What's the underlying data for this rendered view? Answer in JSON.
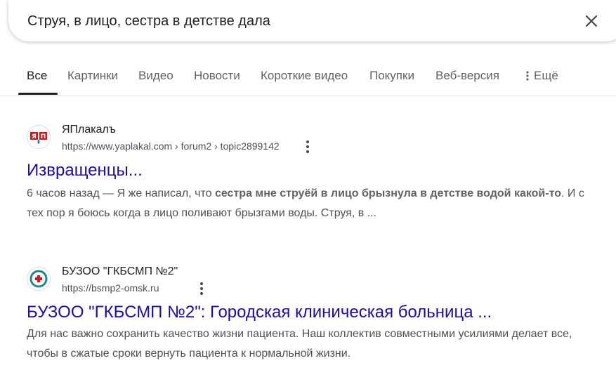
{
  "search": {
    "query": "Струя, в лицо, сестра в детстве дала",
    "clear_icon": "close-icon"
  },
  "tabs": [
    {
      "label": "Все",
      "active": true
    },
    {
      "label": "Картинки"
    },
    {
      "label": "Видео"
    },
    {
      "label": "Новости"
    },
    {
      "label": "Короткие видео"
    },
    {
      "label": "Покупки"
    },
    {
      "label": "Веб-версия"
    },
    {
      "label": "Ещё",
      "icon": "more-vert-icon"
    }
  ],
  "results": [
    {
      "site_name": "ЯПлакалъ",
      "url": "https://www.yaplakal.com › forum2 › topic2899142",
      "title": "Извращенцы...",
      "snippet": {
        "date": "6 часов назад",
        "sep": " — ",
        "text1": "Я же написал, что ",
        "bold": "сестра мне струёй в лицо брызнула в детстве водой какой-то",
        "text2": ". И с тех пор я боюсь когда в лицо поливают брызгами воды. Струя, в ..."
      },
      "favicon": "yaplakal-logo-icon"
    },
    {
      "site_name": "БУЗОО \"ГКБСМП №2\"",
      "url": "https://bsmp2-omsk.ru",
      "title": "БУЗОО \"ГКБСМП №2\": Городская клиническая больница ...",
      "snippet": {
        "text": "Для нас важно сохранить качество жизни пациента. Наш коллектив совместными усилиями делает все, чтобы в сжатые сроки вернуть пациента к нормальной жизни."
      },
      "favicon": "hospital-logo-icon"
    }
  ],
  "colors": {
    "link": "#1a0dab",
    "url": "#4d5156",
    "snippet": "#4d5156",
    "tab_inactive": "#5f6368"
  }
}
